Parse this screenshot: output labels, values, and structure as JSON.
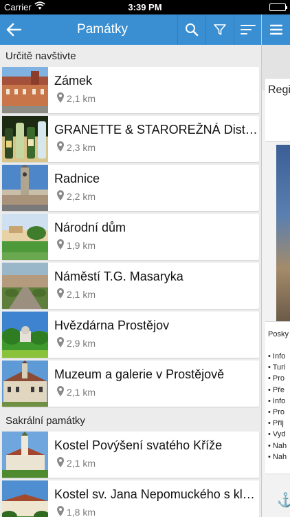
{
  "status_bar": {
    "carrier": "Carrier",
    "time": "3:39 PM"
  },
  "navbar": {
    "title": "Památky",
    "back_icon": "arrow-left-icon",
    "search_icon": "search-icon",
    "filter_icon": "filter-icon",
    "sort_icon": "sort-icon",
    "menu_icon": "hamburger-icon"
  },
  "colors": {
    "accent": "#3a8fd2",
    "background": "#ececec",
    "distance_text": "#7b7b7b"
  },
  "sections": [
    {
      "header": "Určitě navštivte",
      "items": [
        {
          "name": "Zámek",
          "distance": "2,1 km"
        },
        {
          "name": "GRANETTE & STAROREŽNÁ Distiller...",
          "distance": "2,3 km"
        },
        {
          "name": "Radnice",
          "distance": "2,2 km"
        },
        {
          "name": "Národní dům",
          "distance": "1,9 km"
        },
        {
          "name": "Náměstí T.G. Masaryka",
          "distance": "2,1 km"
        },
        {
          "name": "Hvězdárna Prostějov",
          "distance": "2,9 km"
        },
        {
          "name": "Muzeum a galerie v Prostějově",
          "distance": "2,1 km"
        }
      ]
    },
    {
      "header": "Sakrální památky",
      "items": [
        {
          "name": "Kostel Povýšení svatého Kříže",
          "distance": "2,1 km"
        },
        {
          "name": "Kostel sv. Jana Nepomuckého s kláš.",
          "distance": "1,8 km"
        }
      ]
    }
  ],
  "side_panel": {
    "card_title": "Regi",
    "info_heading": "Posky",
    "info_items": [
      "Info",
      "Turi",
      "Pro",
      "Pře",
      "Info",
      "Pro",
      "Přij",
      "Vyd",
      "Nah",
      "Nah"
    ],
    "bottom_icon": "anchor-icon"
  }
}
